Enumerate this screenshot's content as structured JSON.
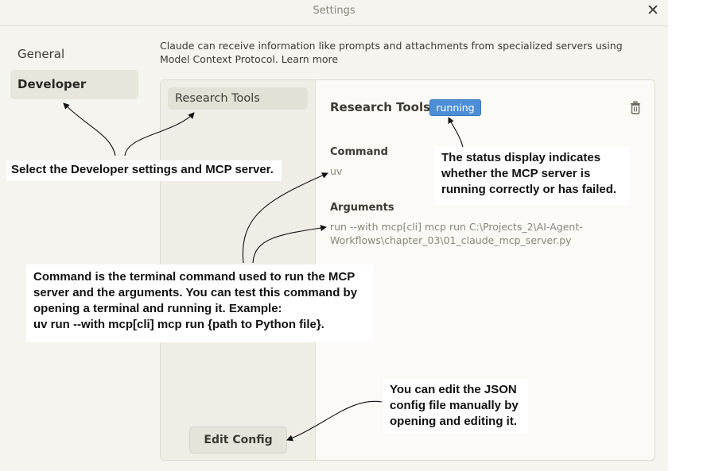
{
  "window": {
    "title": "Settings"
  },
  "nav": {
    "items": [
      {
        "label": "General",
        "selected": false
      },
      {
        "label": "Developer",
        "selected": true
      }
    ]
  },
  "developer": {
    "intro_text": "Claude can receive information like prompts and attachments from specialized servers using Model Context Protocol.",
    "learn_more": "Learn more",
    "servers": [
      {
        "name": "Research Tools"
      }
    ],
    "edit_config_label": "Edit Config",
    "detail": {
      "name": "Research Tools",
      "status": "running",
      "command_label": "Command",
      "command": "uv",
      "arguments_label": "Arguments",
      "arguments": "run --with mcp[cli] mcp run C:\\Projects_2\\AI-Agent-Workflows\\chapter_03\\01_claude_mcp_server.py"
    }
  },
  "annotations": {
    "select_developer": "Select the Developer settings and MCP server.",
    "status_display": "The status display indicates\nwhether the MCP server is\nrunning correctly or has failed.",
    "command_explanation": "Command is the terminal command used to run the MCP\nserver and the arguments. You can test this command by\nopening a terminal and running it. Example:\nuv run --with mcp[cli] mcp run {path to Python file}.",
    "edit_config": "You can edit the JSON\nconfig file manually by\nopening and editing it."
  },
  "colors": {
    "status_running": "#4d8ed8",
    "background": "#f5f4ef",
    "annotation_arrow": "#111111"
  },
  "icons": {
    "close": "close-icon",
    "delete": "trash-icon"
  }
}
